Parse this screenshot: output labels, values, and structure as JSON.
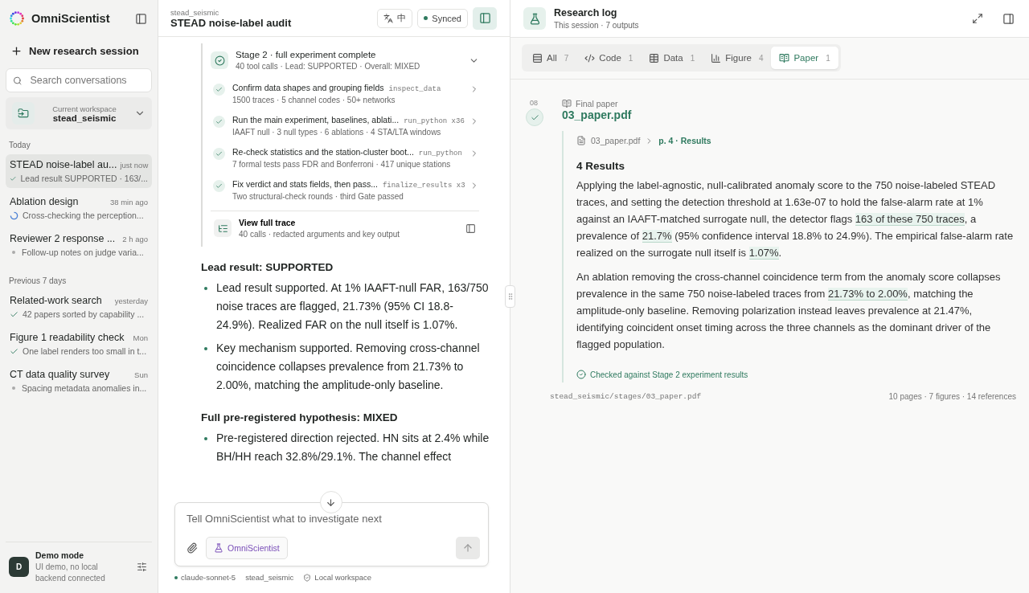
{
  "app": {
    "name": "OmniScientist"
  },
  "sidebar": {
    "new_session": "New research session",
    "search": {
      "placeholder": "Search conversations"
    },
    "workspace": {
      "label": "Current workspace",
      "name": "stead_seismic"
    },
    "groups": [
      {
        "heading": "Today",
        "sessions": [
          {
            "title": "STEAD noise-label au...",
            "time": "just now",
            "summary": "Lead result SUPPORTED · 163/...",
            "kind": "done",
            "selected": true
          },
          {
            "title": "Ablation design",
            "time": "38 min ago",
            "summary": "Cross-checking the perception...",
            "kind": "running",
            "selected": false
          },
          {
            "title": "Reviewer 2 response ...",
            "time": "2 h ago",
            "summary": "Follow-up notes on judge varia...",
            "kind": "idle",
            "selected": false
          }
        ]
      },
      {
        "heading": "Previous 7 days",
        "sessions": [
          {
            "title": "Related-work search",
            "time": "yesterday",
            "summary": "42 papers sorted by capability ...",
            "kind": "done",
            "selected": false
          },
          {
            "title": "Figure 1 readability check",
            "time": "Mon",
            "summary": "One label renders too small in t...",
            "kind": "done",
            "selected": false
          },
          {
            "title": "CT data quality survey",
            "time": "Sun",
            "summary": "Spacing metadata anomalies in...",
            "kind": "idle",
            "selected": false
          }
        ]
      }
    ],
    "user": {
      "initial": "D",
      "name": "Demo mode",
      "status": "UI demo, no local backend connected"
    }
  },
  "chat": {
    "workspace": "stead_seismic",
    "title": "STEAD noise-label audit",
    "language": "中",
    "sync": "Synced",
    "stage": {
      "title": "Stage 2 · full experiment complete",
      "summary": "40 tool calls · Lead: SUPPORTED · Overall: MIXED",
      "expanded": true,
      "steps": [
        {
          "title": "Confirm data shapes and grouping fields",
          "tool": "inspect_data",
          "summary": "1500 traces · 5 channel codes · 50+ networks"
        },
        {
          "title": "Run the main experiment, baselines, ablati...",
          "tool": "run_python x36",
          "summary": "IAAFT null · 3 null types · 6 ablations · 4 STA/LTA windows"
        },
        {
          "title": "Re-check statistics and the station-cluster boot...",
          "tool": "run_python",
          "summary": "7 formal tests pass FDR and Bonferroni · 417 unique stations"
        },
        {
          "title": "Fix verdict and stats fields, then pass...",
          "tool": "finalize_results x3",
          "summary": "Two structural-check rounds · third Gate passed"
        }
      ],
      "trace": {
        "title": "View full trace",
        "summary": "40 calls · redacted arguments and key output"
      }
    },
    "sections": [
      {
        "heading": "Lead result: SUPPORTED",
        "bullets": [
          "Lead result supported. At 1% IAAFT-null FAR, 163/750 noise traces are flagged, 21.73% (95% CI 18.8-24.9%). Realized FAR on the null itself is 1.07%.",
          "Key mechanism supported. Removing cross-channel coincidence collapses prevalence from 21.73% to 2.00%, matching the amplitude-only baseline."
        ]
      },
      {
        "heading": "Full pre-registered hypothesis: MIXED",
        "bullets": [
          "Pre-registered direction rejected. HN sits at 2.4% while BH/HH reach 32.8%/29.1%. The channel effect"
        ]
      }
    ],
    "composer": {
      "placeholder": "Tell OmniScientist what to investigate next",
      "agent": "OmniScientist",
      "send_disabled": true
    },
    "footer": {
      "model": "claude-sonnet-5",
      "workspace": "stead_seismic",
      "mode": "Local workspace"
    }
  },
  "log": {
    "title": "Research log",
    "subtitle": "This session · 7 outputs",
    "tabs": [
      {
        "kind": "all",
        "label": "All",
        "count": "7",
        "selected": false
      },
      {
        "kind": "code",
        "label": "Code",
        "count": "1",
        "selected": false
      },
      {
        "kind": "data",
        "label": "Data",
        "count": "1",
        "selected": false
      },
      {
        "kind": "figure",
        "label": "Figure",
        "count": "4",
        "selected": false
      },
      {
        "kind": "paper",
        "label": "Paper",
        "count": "1",
        "selected": true
      }
    ],
    "entry": {
      "number": "08",
      "type": "Final paper",
      "file": "03_paper.pdf",
      "crumb_file": "03_paper.pdf",
      "crumb_section": "p. 4 · Results",
      "heading": "4 Results",
      "paragraphs": [
        {
          "segments": [
            {
              "text": "Applying the label-agnostic, null-calibrated anomaly score to the 750 noise-labeled STEAD traces, and setting the detection threshold at 1.63e-07 to hold the false-alarm rate at 1% against an IAAFT-matched surrogate null, the detector flags ",
              "highlighted": false
            },
            {
              "text": "163 of these 750 traces",
              "highlighted": true
            },
            {
              "text": ", a prevalence of ",
              "highlighted": false
            },
            {
              "text": "21.7%",
              "highlighted": true
            },
            {
              "text": " (95% confidence interval 18.8% to 24.9%). The empirical false-alarm rate realized on the surrogate null itself is ",
              "highlighted": false
            },
            {
              "text": "1.07%",
              "highlighted": true
            },
            {
              "text": ".",
              "highlighted": false
            }
          ]
        },
        {
          "segments": [
            {
              "text": "An ablation removing the cross-channel coincidence term from the anomaly score collapses prevalence in the same 750 noise-labeled traces from ",
              "highlighted": false
            },
            {
              "text": "21.73% to 2.00%",
              "highlighted": true
            },
            {
              "text": ", matching the amplitude-only baseline. Removing polarization instead leaves prevalence at 21.47%, identifying coincident onset timing across the three channels as the dominant driver of the flagged population.",
              "highlighted": false
            }
          ]
        }
      ],
      "check": "Checked against Stage 2 experiment results",
      "path": "stead_seismic/stages/03_paper.pdf",
      "stats": "10 pages · 7 figures · 14 references"
    }
  }
}
